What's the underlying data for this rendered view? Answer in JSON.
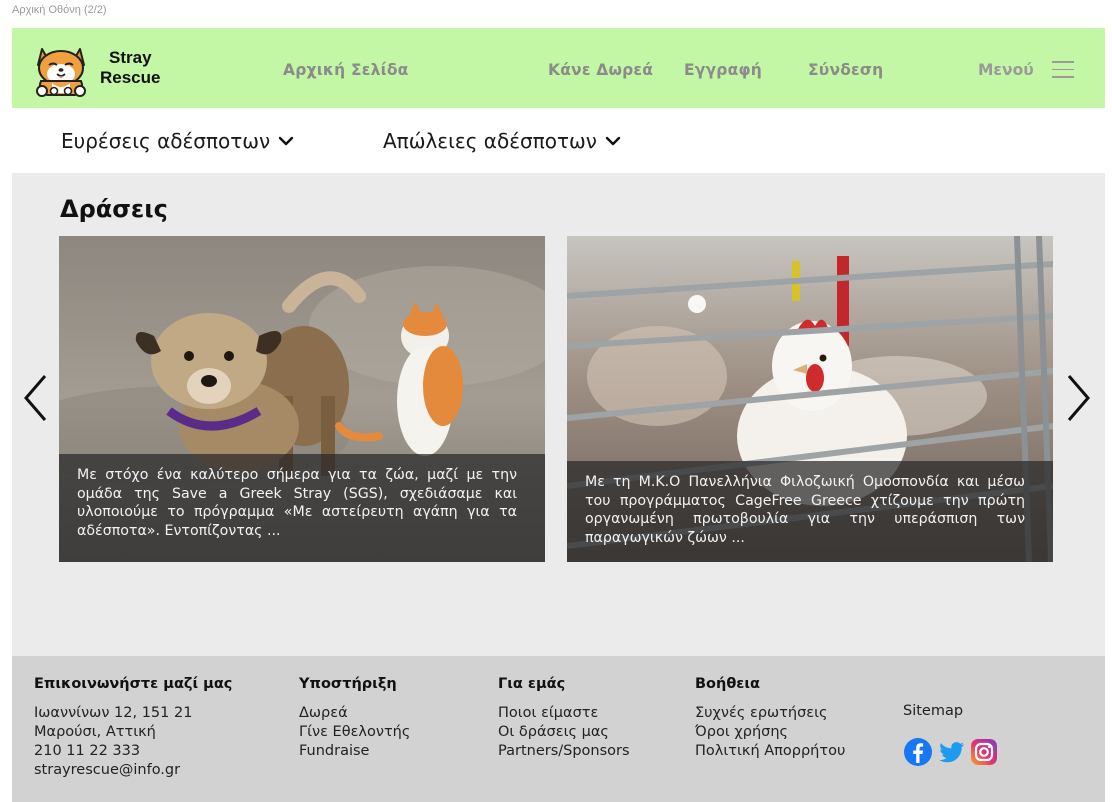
{
  "frame_title": "Αρχική Οθόνη (2/2)",
  "header": {
    "brand_line1": "Stray",
    "brand_line2": "Rescue",
    "nav": {
      "home": "Αρχική Σελίδα",
      "donate": "Κάνε Δωρεά",
      "register": "Εγγραφή",
      "login": "Σύνδεση"
    },
    "menu_label": "Μενού",
    "colors": {
      "background": "#c3f6a5",
      "nav_text": "#8b8b8b"
    }
  },
  "subnav": {
    "found": "Ευρέσεις αδέσποτων",
    "lost": "Απώλειες αδέσποτων"
  },
  "section": {
    "title": "Δράσεις"
  },
  "cards": [
    {
      "image": "dog-and-cat-photo",
      "caption": "Με  στόχο ένα καλύτερο σήμερα για τα ζώα, μαζί με την ομάδα της Save a Greek Stray (SGS), σχεδιάσαμε και υλοποιούμε το πρόγραμμα «Με αστείρευτη αγάπη για τα αδέσποτα». Εντοπίζοντας ..."
    },
    {
      "image": "chicken-in-cage-photo",
      "caption": "Με τη Μ.Κ.Ο Πανελλήνια Φιλοζωική Ομοσπονδία και μέσω του προγράμματος CageFree Greece χτίζουμε την πρώτη οργανωμένη πρωτοβουλία για την υπεράσπιση των παραγωγικών ζώων ..."
    }
  ],
  "footer": {
    "contact": {
      "title": "Επικοινωνήστε μαζί μας",
      "address1": "Ιωαννίνων 12, 151 21",
      "address2": "Μαρούσι, Αττική",
      "phone": "210 11 22 333",
      "email": "strayrescue@info.gr"
    },
    "support": {
      "title": "Υποστήριξη",
      "links": [
        "Δωρεά",
        "Γίνε Εθελοντής",
        "Fundraise"
      ]
    },
    "about": {
      "title": "Για εμάς",
      "links": [
        "Ποιοι είμαστε",
        "Οι δράσεις μας",
        "Partners/Sponsors"
      ]
    },
    "help": {
      "title": "Βοήθεια",
      "links": [
        "Συχνές ερωτήσεις",
        "Όροι χρήσης",
        "Πολιτική Απορρήτου"
      ]
    },
    "sitemap": "Sitemap",
    "social_icons": [
      "facebook-icon",
      "twitter-icon",
      "instagram-icon"
    ],
    "colors": {
      "background": "#d2d2d2",
      "facebook": "#1877f2",
      "twitter": "#1d9bf0"
    }
  }
}
